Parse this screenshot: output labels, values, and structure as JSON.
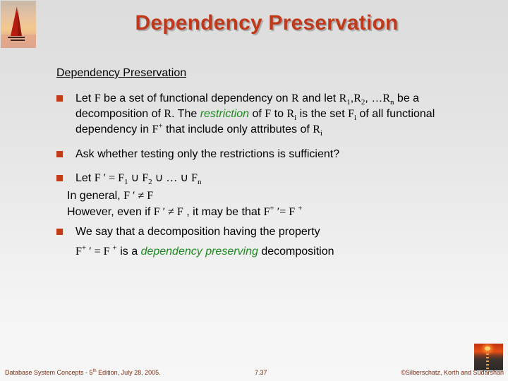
{
  "slide": {
    "title": "Dependency Preservation",
    "subheading": "Dependency Preservation",
    "bullets": [
      {
        "t1": "Let ",
        "F": "F",
        "t2": " be a set of functional dependency on ",
        "R": "R",
        "t3": " and let ",
        "R1": "R",
        "s1": "1",
        "c1": ",",
        "R2": "R",
        "s2": "2",
        "c2": ", …",
        "Rn": "R",
        "sn": "n",
        "t4": " be a decomposition of ",
        "R_b": "R",
        "t5": ". The ",
        "restriction": "restriction",
        "t6": " of ",
        "F_b": "F",
        "t7": " to ",
        "Ri": "R",
        "si": "i",
        "t8": "  is the set ",
        "Fi": "F",
        "sfi": "i",
        "t9": " of all functional dependency in ",
        "Fplus": "F",
        "plus": "+",
        "t10": " that include only attributes of ",
        "Ri2": "R",
        "si2": "i"
      },
      {
        "text": "Ask whether testing only the restrictions is sufficient?"
      },
      {
        "let": "Let ",
        "Fprime": "F ′ = F",
        "s1": "1",
        "u1": " ∪ F",
        "s2": "2",
        "u2": " ∪ … ∪ F",
        "sn": "n",
        "general_label": "In general, ",
        "general_expr": "F ′ ≠ F",
        "however_label": "However, even if ",
        "however_expr": "F ′ ≠ F",
        "however_mid": " , it may be that ",
        "fp": "F",
        "fp_sup": "+",
        "fp_rest": " ′= F ",
        "fp_sup2": "+"
      },
      {
        "text": "We say that a decomposition having the property",
        "expr_F": "F",
        "expr_sup": "+",
        "expr_rest": " ′ = F ",
        "expr_sup2": "+",
        "mid": "  is a ",
        "term": "dependency preserving",
        "end": " decomposition"
      }
    ]
  },
  "footer": {
    "left_pre": "Database System Concepts - 5",
    "left_sup": "th",
    "left_post": " Edition, July 28, 2005.",
    "page": "7.37",
    "copyright": "©Silberschatz, Korth and Sudarshan"
  },
  "colors": {
    "title": "#c0391b",
    "bullet": "#c23a16",
    "emphasis": "#1f8a1f",
    "footer": "#7a2b12"
  }
}
